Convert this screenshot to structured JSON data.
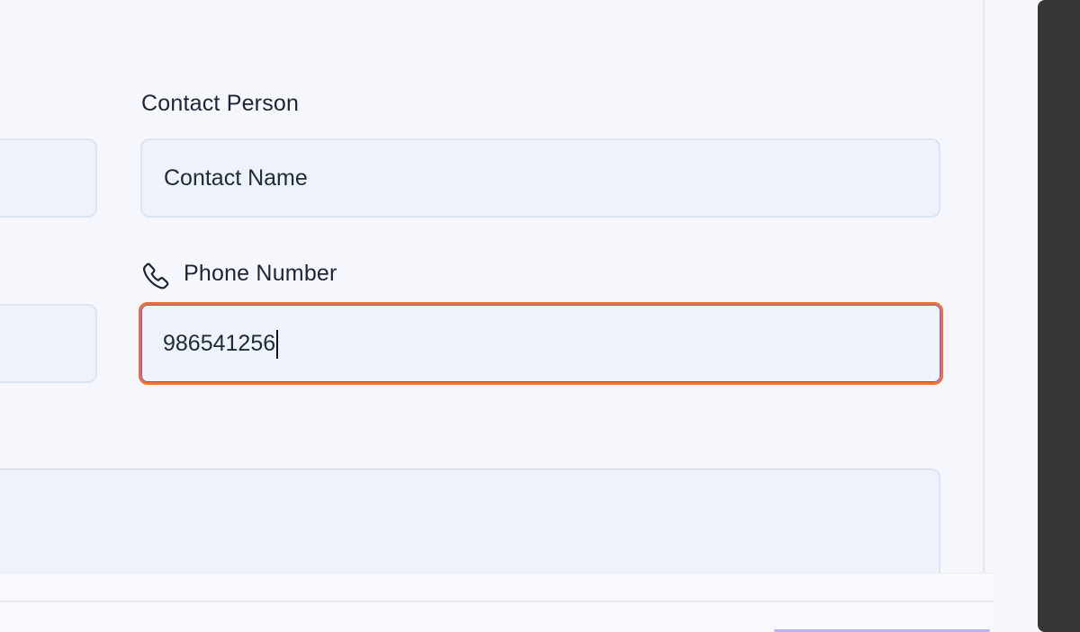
{
  "form": {
    "contact_label": "Contact Person",
    "contact_value": "Contact Name",
    "phone_label": "Phone Number",
    "phone_value": "986541256"
  },
  "icons": {
    "phone": "phone-icon"
  },
  "colors": {
    "focus_ring": "#f16d3a",
    "inner_focus": "#6c56f4",
    "field_background": "#eef2fb",
    "text": "#1d2433"
  }
}
